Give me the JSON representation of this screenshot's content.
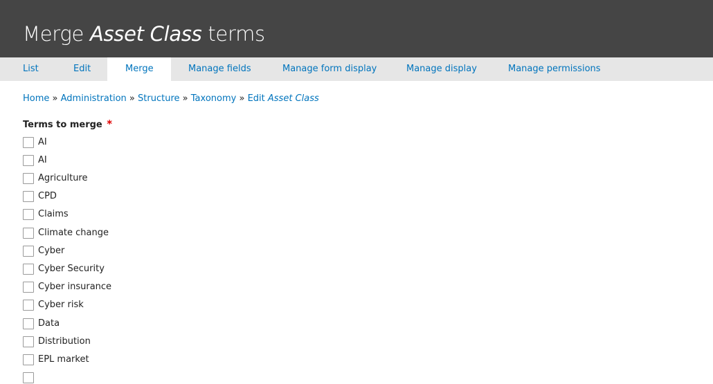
{
  "header": {
    "title_prefix": "Merge ",
    "title_entity": "Asset Class",
    "title_suffix": " terms"
  },
  "tabs": [
    {
      "label": "List",
      "active": false
    },
    {
      "label": "Edit",
      "active": false
    },
    {
      "label": "Merge",
      "active": true
    },
    {
      "label": "Manage fields",
      "active": false
    },
    {
      "label": "Manage form display",
      "active": false
    },
    {
      "label": "Manage display",
      "active": false
    },
    {
      "label": "Manage permissions",
      "active": false
    }
  ],
  "breadcrumb": {
    "items": [
      "Home",
      "Administration",
      "Structure",
      "Taxonomy"
    ],
    "last_prefix": "Edit ",
    "last_entity": "Asset Class",
    "separator": "»"
  },
  "form": {
    "field_label": "Terms to merge",
    "required_marker": "*",
    "options": [
      {
        "label": "AI",
        "checked": false
      },
      {
        "label": "AI",
        "checked": false
      },
      {
        "label": "Agriculture",
        "checked": false
      },
      {
        "label": "CPD",
        "checked": false
      },
      {
        "label": "Claims",
        "checked": false
      },
      {
        "label": "Climate change",
        "checked": false
      },
      {
        "label": "Cyber",
        "checked": false
      },
      {
        "label": "Cyber Security",
        "checked": false
      },
      {
        "label": "Cyber insurance",
        "checked": false
      },
      {
        "label": "Cyber risk",
        "checked": false
      },
      {
        "label": "Data",
        "checked": false
      },
      {
        "label": "Distribution",
        "checked": false
      },
      {
        "label": "EPL market",
        "checked": false
      },
      {
        "label": "",
        "checked": false
      }
    ]
  },
  "colors": {
    "header_bg": "#454545",
    "tab_bar_bg": "#e6e6e6",
    "link": "#0074bd",
    "required": "#e00000"
  }
}
